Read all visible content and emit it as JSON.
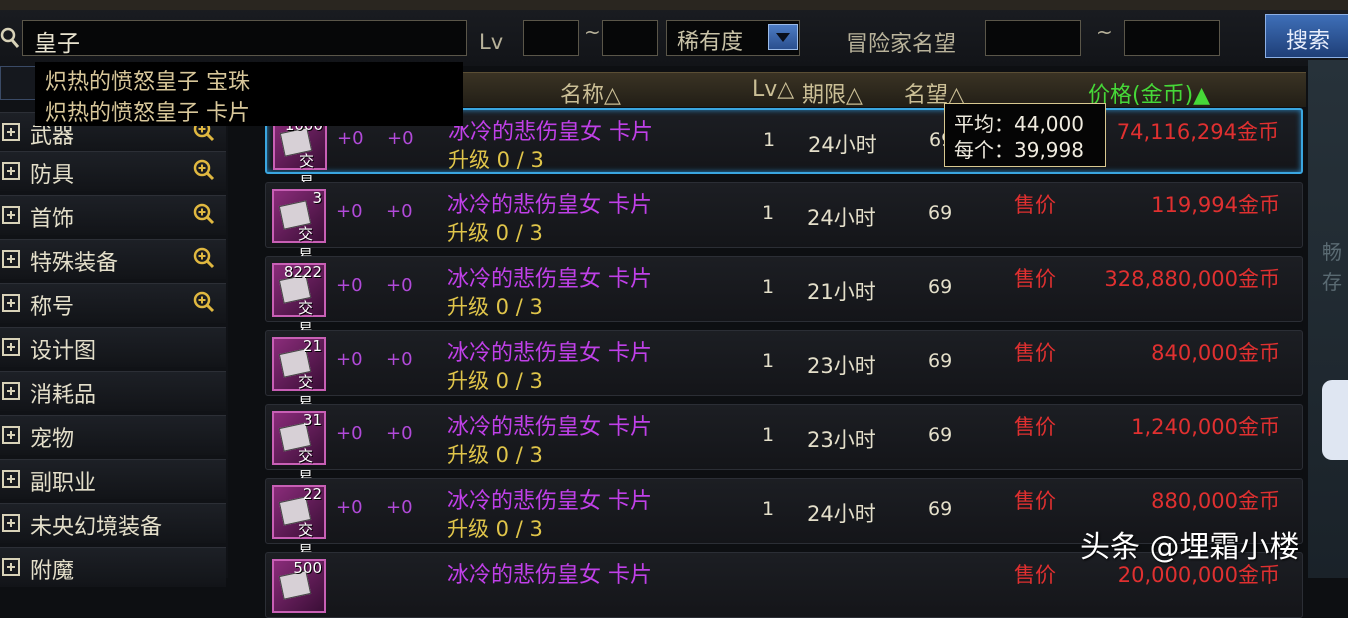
{
  "search": {
    "query": "皇子",
    "lv_label": "Lv",
    "tilde": "~",
    "rarity_label": "稀有度",
    "fame_label": "冒险家名望",
    "button": "搜索"
  },
  "suggestions": [
    "炽热的愤怒皇子 宝珠",
    "炽热的愤怒皇子 卡片"
  ],
  "sidebar": {
    "items": [
      {
        "label": "武器",
        "zoom": true
      },
      {
        "label": "防具",
        "zoom": true
      },
      {
        "label": "首饰",
        "zoom": true
      },
      {
        "label": "特殊装备",
        "zoom": true
      },
      {
        "label": "称号",
        "zoom": true
      },
      {
        "label": "设计图",
        "zoom": false
      },
      {
        "label": "消耗品",
        "zoom": false
      },
      {
        "label": "宠物",
        "zoom": false
      },
      {
        "label": "副职业",
        "zoom": false
      },
      {
        "label": "未央幻境装备",
        "zoom": false
      },
      {
        "label": "附魔",
        "zoom": false
      }
    ]
  },
  "headers": {
    "name": "名称△",
    "lv": "Lv△",
    "duration": "期限△",
    "fame": "名望△",
    "price": "价格(金币)▲"
  },
  "tooltip": {
    "avg": "平均：44,000",
    "each": "每个：39,998"
  },
  "listings": [
    {
      "count": "1000",
      "trade": "交易",
      "plus1": "+0",
      "plus2": "+0",
      "name": "冰冷的悲伤皇女 卡片",
      "upgrade": "升级 0 / 3",
      "lv": "1",
      "duration": "24小时",
      "fame": "69",
      "sale": "",
      "price": "74,116,294金币"
    },
    {
      "count": "3",
      "trade": "交易",
      "plus1": "+0",
      "plus2": "+0",
      "name": "冰冷的悲伤皇女 卡片",
      "upgrade": "升级 0 / 3",
      "lv": "1",
      "duration": "24小时",
      "fame": "69",
      "sale": "售价",
      "price": "119,994金币"
    },
    {
      "count": "8222",
      "trade": "交易",
      "plus1": "+0",
      "plus2": "+0",
      "name": "冰冷的悲伤皇女 卡片",
      "upgrade": "升级 0 / 3",
      "lv": "1",
      "duration": "21小时",
      "fame": "69",
      "sale": "售价",
      "price": "328,880,000金币"
    },
    {
      "count": "21",
      "trade": "交易",
      "plus1": "+0",
      "plus2": "+0",
      "name": "冰冷的悲伤皇女 卡片",
      "upgrade": "升级 0 / 3",
      "lv": "1",
      "duration": "23小时",
      "fame": "69",
      "sale": "售价",
      "price": "840,000金币"
    },
    {
      "count": "31",
      "trade": "交易",
      "plus1": "+0",
      "plus2": "+0",
      "name": "冰冷的悲伤皇女 卡片",
      "upgrade": "升级 0 / 3",
      "lv": "1",
      "duration": "23小时",
      "fame": "69",
      "sale": "售价",
      "price": "1,240,000金币"
    },
    {
      "count": "22",
      "trade": "交易",
      "plus1": "+0",
      "plus2": "+0",
      "name": "冰冷的悲伤皇女 卡片",
      "upgrade": "升级 0 / 3",
      "lv": "1",
      "duration": "24小时",
      "fame": "69",
      "sale": "售价",
      "price": "880,000金币"
    },
    {
      "count": "500",
      "trade": "",
      "plus1": "",
      "plus2": "",
      "name": "冰冷的悲伤皇女 卡片",
      "upgrade": "",
      "lv": "",
      "duration": "",
      "fame": "",
      "sale": "售价",
      "price": "20,000,000金币"
    }
  ],
  "right_panel": {
    "text1": "畅",
    "text2": "存"
  },
  "watermark": "头条 @埋霜小楼"
}
